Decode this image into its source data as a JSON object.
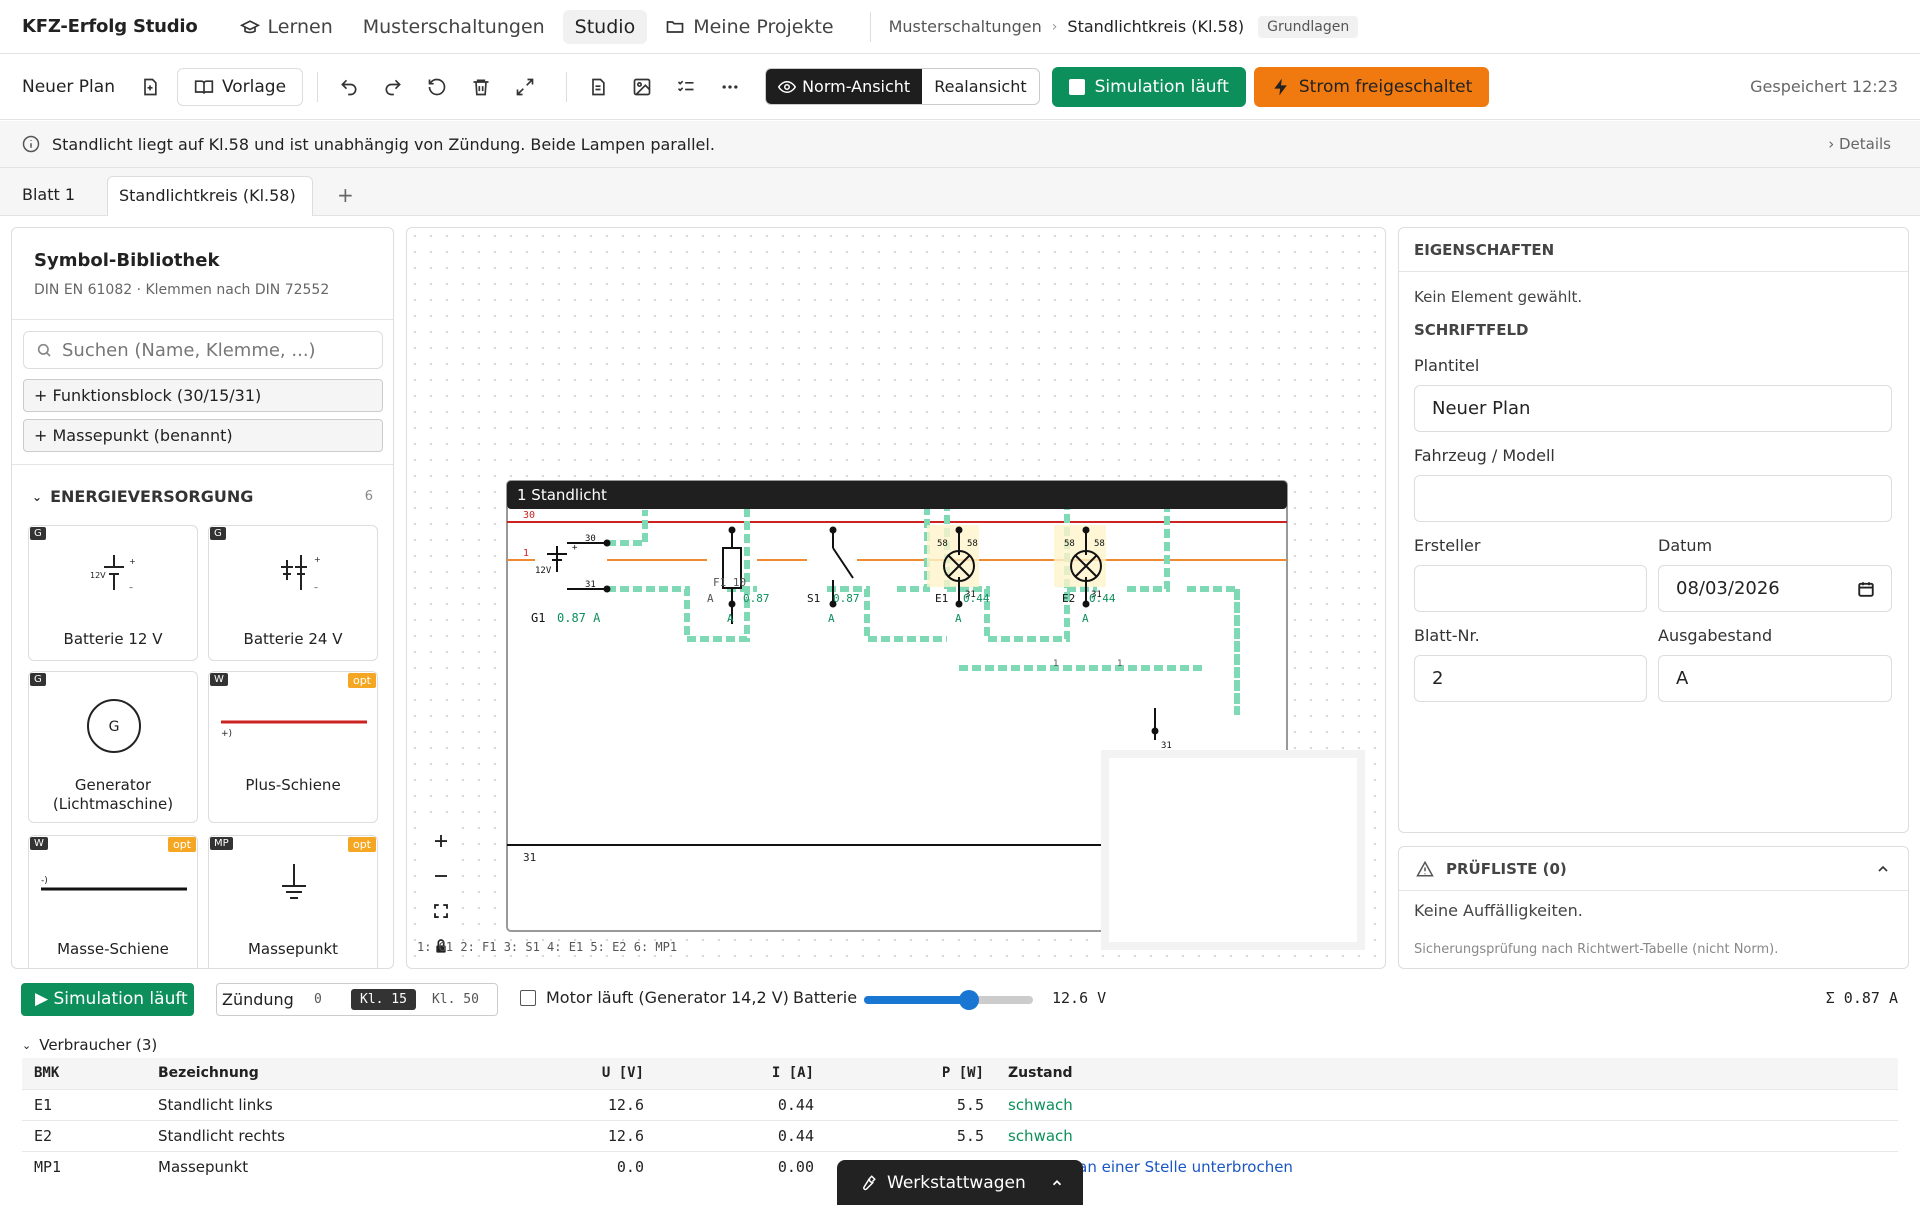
{
  "topbar": {
    "brand": "KFZ-Erfolg Studio",
    "nav": [
      "Lernen",
      "Musterschaltungen",
      "Studio",
      "Meine Projekte"
    ],
    "breadcrumb": [
      "Musterschaltungen",
      "Standlichtkreis (Kl.58)"
    ],
    "tag": "Grundlagen"
  },
  "toolbar": {
    "plan_name": "Neuer Plan",
    "vorlage": "Vorlage",
    "view_norm": "Norm-Ansicht",
    "view_real": "Realansicht",
    "simulation": "Simulation läuft",
    "power": "Strom freigeschaltet",
    "saved": "Gespeichert 12:23"
  },
  "info": {
    "text": "Standlicht liegt auf Kl.58 und ist unabhängig von Zündung. Beide Lampen parallel.",
    "details": "Details"
  },
  "tabs": [
    "Blatt 1",
    "Standlichtkreis (Kl.58)"
  ],
  "library": {
    "title": "Symbol-Bibliothek",
    "subtitle": "DIN EN 61082 · Klemmen nach DIN 72552",
    "search_placeholder": "Suchen (Name, Klemme, ...)",
    "add_block": "+ Funktionsblock (30/15/31)",
    "add_ground": "+ Massepunkt (benannt)",
    "section": "ENERGIEVERSORGUNG",
    "section_count": "6",
    "items": [
      {
        "badge": "G",
        "name": "Batterie 12 V",
        "opt": ""
      },
      {
        "badge": "G",
        "name": "Batterie 24 V",
        "opt": ""
      },
      {
        "badge": "G",
        "name": "Generator (Lichtmaschine)",
        "opt": ""
      },
      {
        "badge": "W",
        "name": "Plus-Schiene",
        "opt": "opt"
      },
      {
        "badge": "W",
        "name": "Masse-Schiene",
        "opt": "opt"
      },
      {
        "badge": "MP",
        "name": "Massepunkt",
        "opt": "opt"
      }
    ]
  },
  "canvas": {
    "block_title": "1 Standlicht",
    "legend": "1: G1  2: F1  3: S1  4: E1  5: E2  6: MP1",
    "labels": {
      "t30": "30",
      "t1": "1",
      "t31": "31",
      "t58": "58",
      "g1": "G1",
      "f1": "F1 10",
      "s1": "S1",
      "e1": "E1",
      "e2": "E2",
      "a": "A",
      "v12": "12V",
      "amp087": "0.87",
      "amp044": "0.44",
      "g1_amp": "0.87 A",
      "plus": "+",
      "minus": "–",
      "one": "1"
    }
  },
  "properties": {
    "title": "EIGENSCHAFTEN",
    "none": "Kein Element gewählt.",
    "section": "SCHRIFTFELD",
    "plantitel_label": "Plantitel",
    "plantitel": "Neuer Plan",
    "fahrzeug_label": "Fahrzeug / Modell",
    "fahrzeug": "",
    "ersteller_label": "Ersteller",
    "ersteller": "",
    "datum_label": "Datum",
    "datum": "08/03/2026",
    "blatt_label": "Blatt-Nr.",
    "blatt": "2",
    "ausgabe_label": "Ausgabestand",
    "ausgabe": "A"
  },
  "checklist": {
    "title": "PRÜFLISTE (0)",
    "status": "Keine Auffälligkeiten.",
    "note": "Sicherungsprüfung nach Richtwert-Tabelle (nicht Norm)."
  },
  "simbar": {
    "button": "▶ Simulation läuft",
    "ignition_label": "Zündung",
    "ignition_options": [
      "0",
      "Kl. 15",
      "Kl. 50"
    ],
    "motor": "Motor läuft (Generator 14,2 V)",
    "battery_label": "Batterie",
    "battery_value": 0.62,
    "battery_text": "12.6 V",
    "sum": "Σ 0.87 A"
  },
  "consumers": {
    "title": "Verbraucher (3)",
    "headers": [
      "BMK",
      "Bezeichnung",
      "U [V]",
      "I [A]",
      "P [W]",
      "Zustand"
    ],
    "rows": [
      [
        "E1",
        "Standlicht links",
        "12.6",
        "0.44",
        "5.5",
        "schwach"
      ],
      [
        "E2",
        "Standlicht rechts",
        "12.6",
        "0.44",
        "5.5",
        "schwach"
      ],
      [
        "MP1",
        "Massepunkt",
        "0.0",
        "0.00",
        "",
        "romkreis an einer Stelle unterbrochen"
      ]
    ]
  },
  "werkstatt": "Werkstattwagen",
  "colors": {
    "green": "#0d8f5c",
    "orange": "#f07a10",
    "wire30": "#cc2222",
    "wire_orange": "#f08a30",
    "current": "#7fd9b5"
  }
}
